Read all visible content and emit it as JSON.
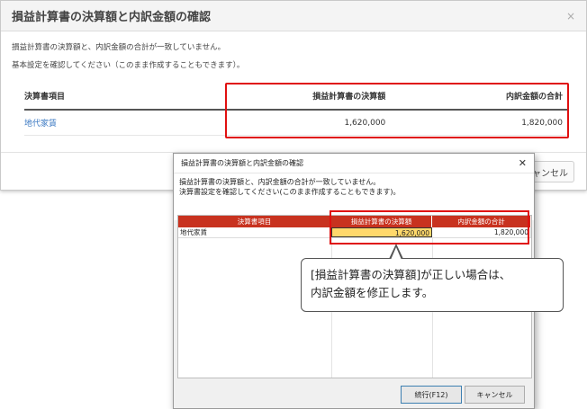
{
  "web_dialog": {
    "title": "損益計算書の決算額と内訳金額の確認",
    "close_symbol": "×",
    "message_line1": "損益計算書の決算額と、内訳金額の合計が一致していません。",
    "message_line2": "基本設定を確認してください（このまま作成することもできます）。",
    "table": {
      "headers": [
        "決算書項目",
        "損益計算書の決算額",
        "内訳金額の合計"
      ],
      "rows": [
        {
          "item": "地代家賃",
          "pl_amount": "1,620,000",
          "breakdown_total": "1,820,000"
        }
      ]
    },
    "cancel_label": "キャンセル"
  },
  "win_dialog": {
    "title": "損益計算書の決算額と内訳金額の確認",
    "close_symbol": "✕",
    "message_line1": "損益計算書の決算額と、内訳金額の合計が一致していません。",
    "message_line2": "決算書設定を確認してください(このまま作成することもできます)。",
    "grid": {
      "headers": [
        "決算書項目",
        "損益計算書の決算額",
        "内訳金額の合計"
      ],
      "rows": [
        {
          "item": "地代家賃",
          "pl_amount": "1,620,000",
          "breakdown_total": "1,820,000"
        }
      ]
    },
    "run_label": "続行(F12)",
    "cancel_label": "キャンセル"
  },
  "callout": {
    "line1": "[損益計算書の決算額]が正しい場合は、",
    "line2": "内訳金額を修正します。"
  },
  "colors": {
    "highlight_box": "#e01010",
    "grid_header": "#c8321f",
    "selected_cell": "#ffd86b",
    "link": "#3a78c2"
  }
}
